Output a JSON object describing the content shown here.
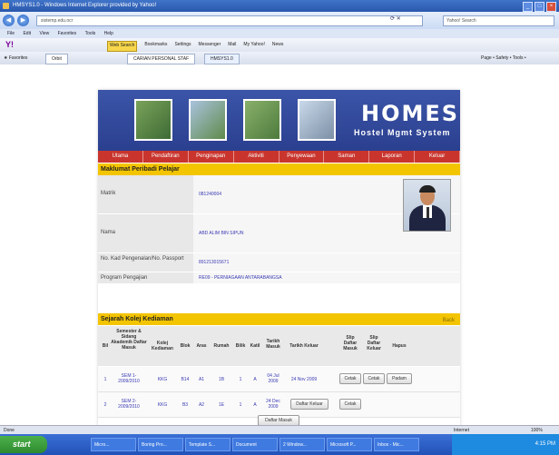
{
  "window": {
    "title": "HMSYS1.0 - Windows Internet Explorer provided by Yahoo!"
  },
  "address": {
    "url": "sistemp.edu.ocr",
    "search_placeholder": "Yahoo! Search"
  },
  "menu": [
    "File",
    "Edit",
    "View",
    "Favorites",
    "Tools",
    "Help"
  ],
  "yahoo_toolbar": {
    "logo": "Y!",
    "web_search": "Web Search",
    "items": [
      "Bookmarks",
      "Settings",
      "Messenger",
      "Mail",
      "My Yahoo!",
      "News"
    ]
  },
  "favorites": {
    "label": "Favorites",
    "tab1": "Orbit",
    "tab2": "CARIAN PERSONAL STAF",
    "tab3": "HMSYS1.0",
    "right_tools": "Page • Safety • Tools •"
  },
  "banner": {
    "title": "HOMES",
    "subtitle": "Hostel Mgmt System"
  },
  "nav": [
    "Utama",
    "Pendaftiran",
    "Penginapan",
    "Aktiviti",
    "Penyewaan",
    "Saman",
    "Laporan",
    "Keluar"
  ],
  "personal": {
    "heading": "Maklumat Peribadi Pelajar",
    "rows": [
      {
        "label": "Matrik",
        "value": "081240004"
      },
      {
        "label": "Nama",
        "value": "ABD ALIM BIN SIPUN"
      },
      {
        "label": "No. Kad Pengenalan/No. Passport",
        "value": "891213015671"
      },
      {
        "label": "Program Pengajian",
        "value": "RE09 - PERNIAGAAN ANTARABANGSA"
      }
    ]
  },
  "history": {
    "heading": "Sejarah Kolej Kediaman",
    "back": "Back",
    "columns": [
      "Bil",
      "Semester & Sidang Akademik Daftar Masuk",
      "Kolej Kediaman",
      "Blok",
      "Aras",
      "Rumah",
      "Bilik",
      "Katil",
      "Tarikh Masuk",
      "Tarikh Keluar",
      "Slip Daftar Masuk",
      "Slip Daftar Keluar",
      "Hapus"
    ],
    "rows": [
      {
        "bil": "1",
        "semester": "SEM 1-2009/2010",
        "kolej": "KKG",
        "blok": "B14",
        "aras": "A1",
        "rumah": "1B",
        "bilik": "1",
        "katil": "A",
        "masuk": "04 Jul 2009",
        "keluar": "24 Nov 2009",
        "slip_masuk": "Cetak",
        "slip_keluar": "Cetak",
        "hapus": "Padam"
      },
      {
        "bil": "2",
        "semester": "SEM 2-2009/2010",
        "kolej": "KKG",
        "blok": "B3",
        "aras": "A2",
        "rumah": "1E",
        "bilik": "1",
        "katil": "A",
        "masuk": "24 Dec 2009",
        "keluar": "Daftar Keluar",
        "slip_masuk": "Cetak",
        "slip_keluar": "",
        "hapus": ""
      }
    ],
    "daftar_masuk": "Daftar Masuk"
  },
  "statusbar": {
    "left": "Done",
    "zone": "Internet",
    "zoom": "100%"
  },
  "taskbar": {
    "start": "start",
    "items": [
      "Micro...",
      "Boring Pro...",
      "Template S...",
      "Document",
      "2 Window...",
      "Microsoft P...",
      "Inbox - Mic..."
    ],
    "clock": "4:15 PM"
  }
}
